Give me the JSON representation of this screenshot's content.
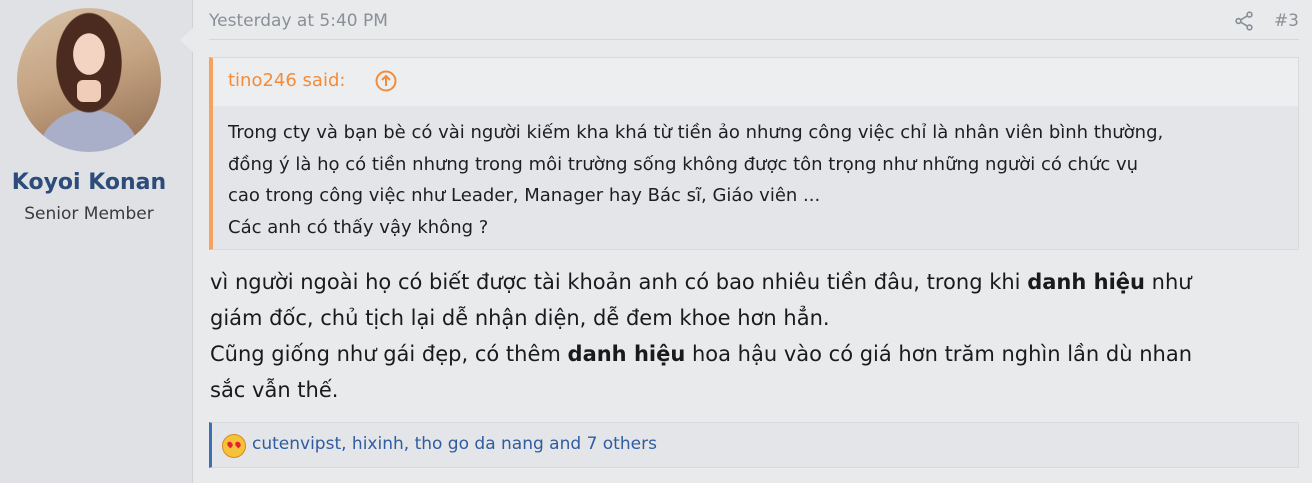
{
  "user": {
    "name": "Koyoi Konan",
    "title": "Senior Member"
  },
  "message": {
    "timestamp": "Yesterday at 5:40 PM",
    "post_number": "#3",
    "icons": {
      "share": "share-icon",
      "quote_jump": "arrow-up-circle-icon",
      "reaction": "love-reaction-icon"
    }
  },
  "quote": {
    "author": "tino246 said:",
    "lines": [
      "Trong cty và bạn bè có vài người kiếm kha khá từ tiền ảo nhưng công việc chỉ là nhân viên bình thường,",
      "đồng ý là họ có tiền nhưng trong môi trường sống không được tôn trọng như những người có chức vụ",
      "cao trong công việc như Leader, Manager hay Bác sĩ, Giáo viên ...",
      "Các anh có thấy vậy không ?"
    ]
  },
  "content": {
    "l1a": "vì người ngoài họ có biết được tài khoản anh có bao nhiêu tiền đâu, trong khi ",
    "l1b": "danh hiệu",
    "l1c": " như",
    "l2": "giám đốc, chủ tịch lại dễ nhận diện, dễ đem khoe hơn hẳn.",
    "l3a": "Cũng giống như gái đẹp, có thêm ",
    "l3b": "danh hiệu",
    "l3c": " hoa hậu vào có giá hơn trăm nghìn lần dù nhan",
    "l4": "sắc vẫn thế."
  },
  "reactions": {
    "text": "cutenvipst, hixinh, tho go da nang and 7 others"
  },
  "colors": {
    "username": "#2d4c7a",
    "quote_accent": "#f7a15c",
    "reaction_accent": "#3d6fb6",
    "reaction_text": "#2f5ca1"
  }
}
